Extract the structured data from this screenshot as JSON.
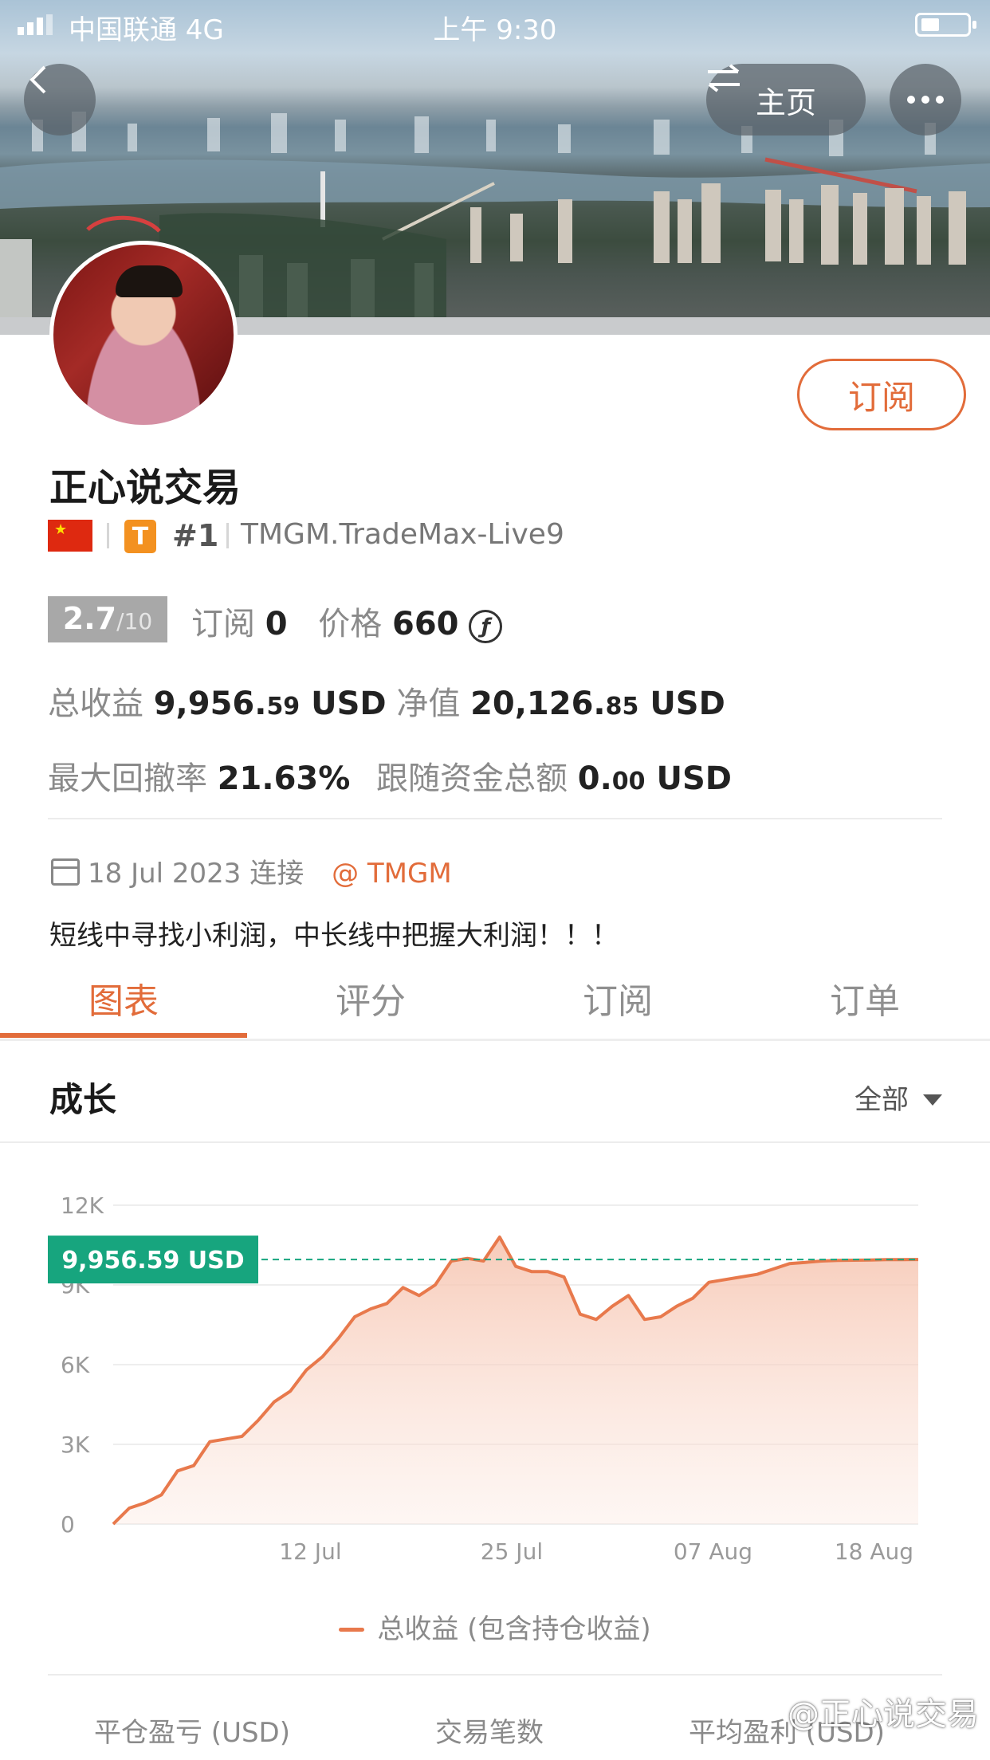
{
  "status_bar": {
    "carrier": "中国联通  4G",
    "time": "上午 9:30"
  },
  "header": {
    "back_icon": "chevron-left-icon",
    "home_label": "主页",
    "home_icon": "swap-arrows-icon",
    "more_icon": "more-dots-icon"
  },
  "profile": {
    "subscribe_label": "订阅",
    "name": "正心说交易",
    "rank": "#1",
    "badge": "T",
    "server": "TMGM.TradeMax-Live9",
    "score": "2.7",
    "score_max": "/10",
    "subscribers_label": "订阅",
    "subscribers": "0",
    "price_label": "价格",
    "price": "660",
    "coin_symbol": "ƒ",
    "total_profit_label": "总收益",
    "total_profit_int": "9,956.",
    "total_profit_dec": "59",
    "currency": "USD",
    "equity_label": "净值",
    "equity_int": "20,126.",
    "equity_dec": "85",
    "drawdown_label": "最大回撤率",
    "drawdown": "21.63%",
    "follow_funds_label": "跟随资金总额",
    "follow_funds_int": "0.",
    "follow_funds_dec": "00",
    "connected": "18 Jul 2023 连接",
    "broker_link": "@ TMGM",
    "bio": "短线中寻找小利润，中长线中把握大利润！！！"
  },
  "tabs": [
    "图表",
    "评分",
    "订阅",
    "订单"
  ],
  "active_tab": 0,
  "section": {
    "title": "成长",
    "filter": "全部"
  },
  "chart_data": {
    "type": "area",
    "title": "",
    "xlabel": "",
    "ylabel": "",
    "ylim": [
      0,
      12000
    ],
    "yticks": [
      "0",
      "3K",
      "6K",
      "9K",
      "12K"
    ],
    "xticks": [
      "12 Jul",
      "25 Jul",
      "07 Aug",
      "18 Aug"
    ],
    "current_label": "9,956.59 USD",
    "current_value": 9956.59,
    "accent_color": "#e8794c",
    "marker_color": "#17a57e",
    "series": [
      {
        "name": "总收益 (包含持仓收益)",
        "x": [
          0,
          0.02,
          0.04,
          0.06,
          0.08,
          0.1,
          0.12,
          0.14,
          0.16,
          0.18,
          0.2,
          0.22,
          0.24,
          0.26,
          0.28,
          0.3,
          0.32,
          0.34,
          0.36,
          0.38,
          0.4,
          0.42,
          0.44,
          0.46,
          0.48,
          0.5,
          0.52,
          0.54,
          0.56,
          0.58,
          0.6,
          0.62,
          0.64,
          0.66,
          0.68,
          0.7,
          0.72,
          0.74,
          0.76,
          0.78,
          0.8,
          0.82,
          0.84,
          0.86,
          0.88,
          0.9,
          0.92,
          0.94,
          0.96,
          0.98,
          1.0
        ],
        "values": [
          0,
          600,
          800,
          1100,
          2000,
          2200,
          3100,
          3200,
          3300,
          3900,
          4600,
          5000,
          5800,
          6300,
          7000,
          7800,
          8100,
          8300,
          8900,
          8600,
          9000,
          9900,
          10000,
          9900,
          10800,
          9700,
          9500,
          9500,
          9300,
          7900,
          7700,
          8200,
          8600,
          7700,
          7800,
          8200,
          8500,
          9100,
          9200,
          9300,
          9400,
          9600,
          9800,
          9850,
          9900,
          9920,
          9930,
          9940,
          9950,
          9955,
          9956.59
        ]
      }
    ]
  },
  "bottom_stats": [
    "平仓盈亏 (USD)",
    "交易笔数",
    "平均盈利 (USD)"
  ],
  "watermark": "@正心说交易"
}
